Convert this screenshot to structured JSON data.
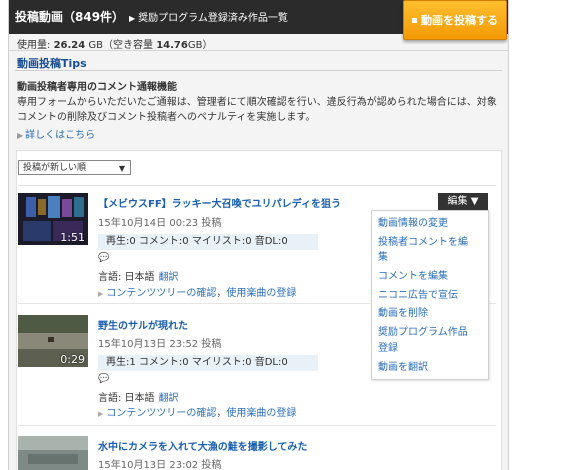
{
  "header": {
    "title": "投稿動画（849件）",
    "breadcrumb": "奨励プログラム登録済み作品一覧",
    "post_button": "動画を投稿する"
  },
  "usage": {
    "label": "使用量:",
    "used": "26.24",
    "used_unit": "GB（空き容量",
    "free": "14.76",
    "free_unit": "GB）"
  },
  "tips": {
    "heading": "動画投稿Tips",
    "subheading": "動画投稿者専用のコメント通報機能",
    "body": "専用フォームからいただいたご通報は、管理者にて順次確認を行い、違反行為が認められた場合には、対象コメントの削除及びコメント投稿者へのペナルティを実施します。",
    "link": "詳しくはこちら"
  },
  "sort": {
    "selected": "投稿が新しい順"
  },
  "videos": [
    {
      "title": "【メビウスFF】ラッキー大召喚でユリパレディを狙う",
      "date": "15年10月14日 00:23 投稿",
      "duration": "1:51",
      "stats": "再生:0 コメント:0 マイリスト:0 音DL:0",
      "language": "言語: 日本語",
      "translate": "翻訳",
      "link1": "コンテンツツリーの確認",
      "link2": "使用楽曲の登録"
    },
    {
      "title": "野生のサルが現れた",
      "date": "15年10月13日 23:52 投稿",
      "duration": "0:29",
      "stats": "再生:1 コメント:0 マイリスト:0 音DL:0",
      "language": "言語: 日本語",
      "translate": "翻訳",
      "link1": "コンテンツツリーの確認",
      "link2": "使用楽曲の登録"
    },
    {
      "title": "水中にカメラを入れて大漁の鮭を撮影してみた",
      "date": "15年10月13日 23:02 投稿"
    }
  ],
  "edit_menu": {
    "button": "編集",
    "items": [
      "動画情報の変更",
      "投稿者コメントを編",
      "集",
      "コメントを編集",
      "ニコニ広告で宣伝",
      "動画を削除",
      "奨励プログラム作品",
      "登録",
      "動画を翻訳"
    ]
  }
}
